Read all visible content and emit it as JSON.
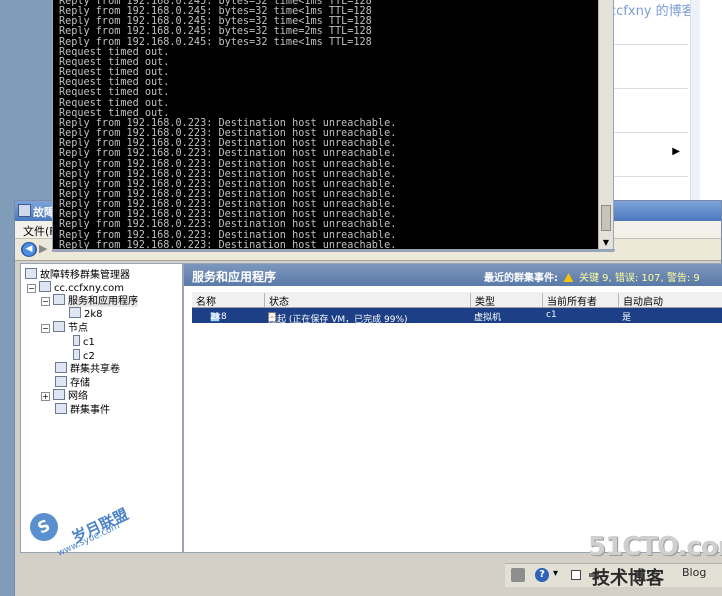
{
  "background": {
    "blog_watermark": "ccfxny 的博客"
  },
  "cmd": {
    "lines": [
      "Reply from 192.168.0.245: bytes=32 time<1ms TTL=128",
      "Reply from 192.168.0.245: bytes=32 time<1ms TTL=128",
      "Reply from 192.168.0.245: bytes=32 time<1ms TTL=128",
      "Reply from 192.168.0.245: bytes=32 time=2ms TTL=128",
      "Reply from 192.168.0.245: bytes=32 time<1ms TTL=128",
      "Request timed out.",
      "Request timed out.",
      "Request timed out.",
      "Request timed out.",
      "Request timed out.",
      "Request timed out.",
      "Request timed out.",
      "Reply from 192.168.0.223: Destination host unreachable.",
      "Reply from 192.168.0.223: Destination host unreachable.",
      "Reply from 192.168.0.223: Destination host unreachable.",
      "Reply from 192.168.0.223: Destination host unreachable.",
      "Reply from 192.168.0.223: Destination host unreachable.",
      "Reply from 192.168.0.223: Destination host unreachable.",
      "Reply from 192.168.0.223: Destination host unreachable.",
      "Reply from 192.168.0.223: Destination host unreachable.",
      "Reply from 192.168.0.223: Destination host unreachable.",
      "Reply from 192.168.0.223: Destination host unreachable.",
      "Reply from 192.168.0.223: Destination host unreachable.",
      "Reply from 192.168.0.223: Destination host unreachable.",
      "Reply from 192.168.0.223: Destination host unreachable."
    ]
  },
  "window": {
    "title": "故障",
    "menu_file": "文件(F"
  },
  "tree": {
    "root": "故障转移群集管理器",
    "cluster": "cc.ccfxny.com",
    "services": "服务和应用程序",
    "vm": "2k8",
    "nodes": "节点",
    "node1": "c1",
    "node2": "c2",
    "shared_volumes": "群集共享卷",
    "storage": "存储",
    "network": "网络",
    "events": "群集事件"
  },
  "content": {
    "title": "服务和应用程序",
    "recent_events_label": "最近的群集事件:",
    "events_summary": "关键 9, 错误: 107, 警告: 9",
    "columns": [
      "名称",
      "状态",
      "类型",
      "当前所有者",
      "自动启动"
    ],
    "row": {
      "name": "2k8",
      "status": "挂起 (正在保存 VM，已完成 99%)",
      "type": "虚拟机",
      "owner": "c1",
      "autostart": "是"
    }
  },
  "watermarks": {
    "site_big": "51CTO.com",
    "site_cn": "技术博客",
    "site_blog": "Blog",
    "left_cn": "岁月联盟",
    "left_url": "www.syue.com",
    "left_logo_letter": "S"
  },
  "colors": {
    "cmd_bg": "#000000",
    "cmd_text": "#c0c0c0",
    "selection": "#1c3f86",
    "header_gradient": "#5a79a8"
  }
}
